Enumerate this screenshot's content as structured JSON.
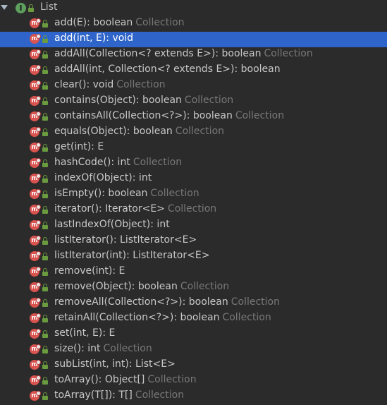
{
  "tree": {
    "root": {
      "label": "List",
      "icon": "interface-icon",
      "icon_letter": "I",
      "expanded": true
    },
    "members": [
      {
        "signature": "add(E): boolean",
        "owner": "Collection",
        "selected": false
      },
      {
        "signature": "add(int, E): void",
        "owner": "",
        "selected": true
      },
      {
        "signature": "addAll(Collection<? extends E>): boolean",
        "owner": "Collection",
        "selected": false
      },
      {
        "signature": "addAll(int, Collection<? extends E>): boolean",
        "owner": "",
        "selected": false
      },
      {
        "signature": "clear(): void",
        "owner": "Collection",
        "selected": false
      },
      {
        "signature": "contains(Object): boolean",
        "owner": "Collection",
        "selected": false
      },
      {
        "signature": "containsAll(Collection<?>): boolean",
        "owner": "Collection",
        "selected": false
      },
      {
        "signature": "equals(Object): boolean",
        "owner": "Collection",
        "selected": false
      },
      {
        "signature": "get(int): E",
        "owner": "",
        "selected": false
      },
      {
        "signature": "hashCode(): int",
        "owner": "Collection",
        "selected": false
      },
      {
        "signature": "indexOf(Object): int",
        "owner": "",
        "selected": false
      },
      {
        "signature": "isEmpty(): boolean",
        "owner": "Collection",
        "selected": false
      },
      {
        "signature": "iterator(): Iterator<E>",
        "owner": "Collection",
        "selected": false
      },
      {
        "signature": "lastIndexOf(Object): int",
        "owner": "",
        "selected": false
      },
      {
        "signature": "listIterator(): ListIterator<E>",
        "owner": "",
        "selected": false
      },
      {
        "signature": "listIterator(int): ListIterator<E>",
        "owner": "",
        "selected": false
      },
      {
        "signature": "remove(int): E",
        "owner": "",
        "selected": false
      },
      {
        "signature": "remove(Object): boolean",
        "owner": "Collection",
        "selected": false
      },
      {
        "signature": "removeAll(Collection<?>): boolean",
        "owner": "Collection",
        "selected": false
      },
      {
        "signature": "retainAll(Collection<?>): boolean",
        "owner": "Collection",
        "selected": false
      },
      {
        "signature": "set(int, E): E",
        "owner": "",
        "selected": false
      },
      {
        "signature": "size(): int",
        "owner": "Collection",
        "selected": false
      },
      {
        "signature": "subList(int, int): List<E>",
        "owner": "",
        "selected": false
      },
      {
        "signature": "toArray(): Object[]",
        "owner": "Collection",
        "selected": false
      },
      {
        "signature": "toArray(T[]): T[]",
        "owner": "Collection",
        "selected": false
      }
    ]
  },
  "colors": {
    "background": "#2b2b2b",
    "selection": "#2f65ca",
    "owner_text": "#787878",
    "method_icon": "#d9534f",
    "interface_icon": "#5e9f5e",
    "lock": "#6a9b3f"
  },
  "icons": {
    "method": "method-icon",
    "visibility": "public-lock-icon",
    "expander": "chevron-down-icon"
  }
}
